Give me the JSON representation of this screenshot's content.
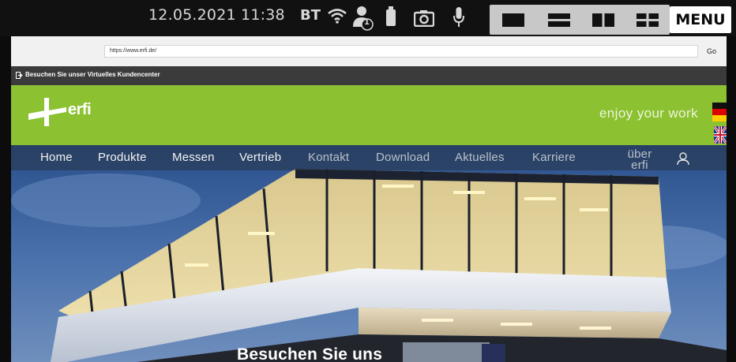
{
  "statusbar": {
    "clock": "12.05.2021 11:38",
    "bt_label": "BT",
    "icons": [
      "bluetooth",
      "wifi-icon",
      "user-badge-icon",
      "usb-icon",
      "camera-icon",
      "microphone-icon"
    ],
    "user_badge": "1",
    "layouts": [
      "layout-single-icon",
      "layout-horizontal-split-icon",
      "layout-vertical-split-icon",
      "layout-quad-icon"
    ],
    "menu_label": "MENU"
  },
  "browser": {
    "url": "https://www.erfi.de/",
    "go_label": "Go"
  },
  "website": {
    "virtual_link": "Besuchen Sie unser Virtuelles Kundencenter",
    "logo_text": "erfi",
    "tagline": "enjoy your work",
    "nav": [
      "Home",
      "Produkte",
      "Messen",
      "Vertrieb",
      "Kontakt",
      "Download",
      "Aktuelles",
      "Karriere",
      "über erfi"
    ],
    "hero_caption": "Besuchen Sie uns",
    "brand_green": "#8cc132"
  }
}
